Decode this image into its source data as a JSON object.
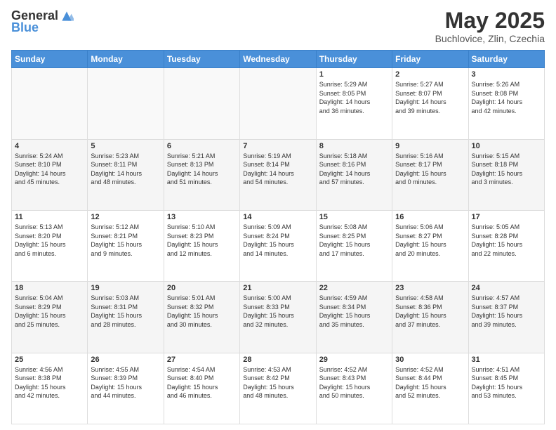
{
  "header": {
    "logo_general": "General",
    "logo_blue": "Blue",
    "month_title": "May 2025",
    "location": "Buchlovice, Zlin, Czechia"
  },
  "weekdays": [
    "Sunday",
    "Monday",
    "Tuesday",
    "Wednesday",
    "Thursday",
    "Friday",
    "Saturday"
  ],
  "weeks": [
    [
      {
        "day": "",
        "info": ""
      },
      {
        "day": "",
        "info": ""
      },
      {
        "day": "",
        "info": ""
      },
      {
        "day": "",
        "info": ""
      },
      {
        "day": "1",
        "info": "Sunrise: 5:29 AM\nSunset: 8:05 PM\nDaylight: 14 hours\nand 36 minutes."
      },
      {
        "day": "2",
        "info": "Sunrise: 5:27 AM\nSunset: 8:07 PM\nDaylight: 14 hours\nand 39 minutes."
      },
      {
        "day": "3",
        "info": "Sunrise: 5:26 AM\nSunset: 8:08 PM\nDaylight: 14 hours\nand 42 minutes."
      }
    ],
    [
      {
        "day": "4",
        "info": "Sunrise: 5:24 AM\nSunset: 8:10 PM\nDaylight: 14 hours\nand 45 minutes."
      },
      {
        "day": "5",
        "info": "Sunrise: 5:23 AM\nSunset: 8:11 PM\nDaylight: 14 hours\nand 48 minutes."
      },
      {
        "day": "6",
        "info": "Sunrise: 5:21 AM\nSunset: 8:13 PM\nDaylight: 14 hours\nand 51 minutes."
      },
      {
        "day": "7",
        "info": "Sunrise: 5:19 AM\nSunset: 8:14 PM\nDaylight: 14 hours\nand 54 minutes."
      },
      {
        "day": "8",
        "info": "Sunrise: 5:18 AM\nSunset: 8:16 PM\nDaylight: 14 hours\nand 57 minutes."
      },
      {
        "day": "9",
        "info": "Sunrise: 5:16 AM\nSunset: 8:17 PM\nDaylight: 15 hours\nand 0 minutes."
      },
      {
        "day": "10",
        "info": "Sunrise: 5:15 AM\nSunset: 8:18 PM\nDaylight: 15 hours\nand 3 minutes."
      }
    ],
    [
      {
        "day": "11",
        "info": "Sunrise: 5:13 AM\nSunset: 8:20 PM\nDaylight: 15 hours\nand 6 minutes."
      },
      {
        "day": "12",
        "info": "Sunrise: 5:12 AM\nSunset: 8:21 PM\nDaylight: 15 hours\nand 9 minutes."
      },
      {
        "day": "13",
        "info": "Sunrise: 5:10 AM\nSunset: 8:23 PM\nDaylight: 15 hours\nand 12 minutes."
      },
      {
        "day": "14",
        "info": "Sunrise: 5:09 AM\nSunset: 8:24 PM\nDaylight: 15 hours\nand 14 minutes."
      },
      {
        "day": "15",
        "info": "Sunrise: 5:08 AM\nSunset: 8:25 PM\nDaylight: 15 hours\nand 17 minutes."
      },
      {
        "day": "16",
        "info": "Sunrise: 5:06 AM\nSunset: 8:27 PM\nDaylight: 15 hours\nand 20 minutes."
      },
      {
        "day": "17",
        "info": "Sunrise: 5:05 AM\nSunset: 8:28 PM\nDaylight: 15 hours\nand 22 minutes."
      }
    ],
    [
      {
        "day": "18",
        "info": "Sunrise: 5:04 AM\nSunset: 8:29 PM\nDaylight: 15 hours\nand 25 minutes."
      },
      {
        "day": "19",
        "info": "Sunrise: 5:03 AM\nSunset: 8:31 PM\nDaylight: 15 hours\nand 28 minutes."
      },
      {
        "day": "20",
        "info": "Sunrise: 5:01 AM\nSunset: 8:32 PM\nDaylight: 15 hours\nand 30 minutes."
      },
      {
        "day": "21",
        "info": "Sunrise: 5:00 AM\nSunset: 8:33 PM\nDaylight: 15 hours\nand 32 minutes."
      },
      {
        "day": "22",
        "info": "Sunrise: 4:59 AM\nSunset: 8:34 PM\nDaylight: 15 hours\nand 35 minutes."
      },
      {
        "day": "23",
        "info": "Sunrise: 4:58 AM\nSunset: 8:36 PM\nDaylight: 15 hours\nand 37 minutes."
      },
      {
        "day": "24",
        "info": "Sunrise: 4:57 AM\nSunset: 8:37 PM\nDaylight: 15 hours\nand 39 minutes."
      }
    ],
    [
      {
        "day": "25",
        "info": "Sunrise: 4:56 AM\nSunset: 8:38 PM\nDaylight: 15 hours\nand 42 minutes."
      },
      {
        "day": "26",
        "info": "Sunrise: 4:55 AM\nSunset: 8:39 PM\nDaylight: 15 hours\nand 44 minutes."
      },
      {
        "day": "27",
        "info": "Sunrise: 4:54 AM\nSunset: 8:40 PM\nDaylight: 15 hours\nand 46 minutes."
      },
      {
        "day": "28",
        "info": "Sunrise: 4:53 AM\nSunset: 8:42 PM\nDaylight: 15 hours\nand 48 minutes."
      },
      {
        "day": "29",
        "info": "Sunrise: 4:52 AM\nSunset: 8:43 PM\nDaylight: 15 hours\nand 50 minutes."
      },
      {
        "day": "30",
        "info": "Sunrise: 4:52 AM\nSunset: 8:44 PM\nDaylight: 15 hours\nand 52 minutes."
      },
      {
        "day": "31",
        "info": "Sunrise: 4:51 AM\nSunset: 8:45 PM\nDaylight: 15 hours\nand 53 minutes."
      }
    ]
  ]
}
